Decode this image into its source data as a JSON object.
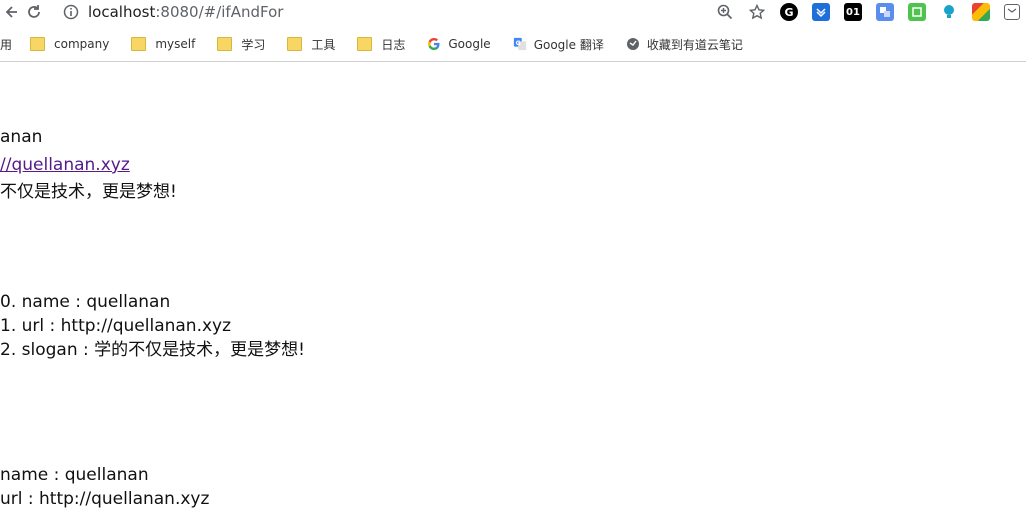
{
  "browser": {
    "url_host": "localhost",
    "url_rest": ":8080/#/ifAndFor",
    "extensions": [
      "G",
      "01"
    ]
  },
  "bookmarks": [
    {
      "label": "用",
      "icon": "none"
    },
    {
      "label": "company",
      "icon": "folder-icon"
    },
    {
      "label": "myself",
      "icon": "folder-icon"
    },
    {
      "label": "学习",
      "icon": "folder-icon"
    },
    {
      "label": "工具",
      "icon": "folder-icon"
    },
    {
      "label": "日志",
      "icon": "folder-icon"
    },
    {
      "label": "Google",
      "icon": "google-icon"
    },
    {
      "label": "Google 翻译",
      "icon": "google-translate-icon"
    },
    {
      "label": "收藏到有道云笔记",
      "icon": "youdao-icon"
    }
  ],
  "content": {
    "block1": {
      "name": "anan",
      "url": "//quellanan.xyz",
      "slogan": "不仅是技术，更是梦想!"
    },
    "block2": [
      "0. name : quellanan",
      "1. url : http://quellanan.xyz",
      "2. slogan : 学的不仅是技术，更是梦想!"
    ],
    "block3": [
      "name : quellanan",
      "url : http://quellanan.xyz"
    ]
  },
  "colors": {
    "link": "#551a8b",
    "folder": "#f7d664"
  }
}
